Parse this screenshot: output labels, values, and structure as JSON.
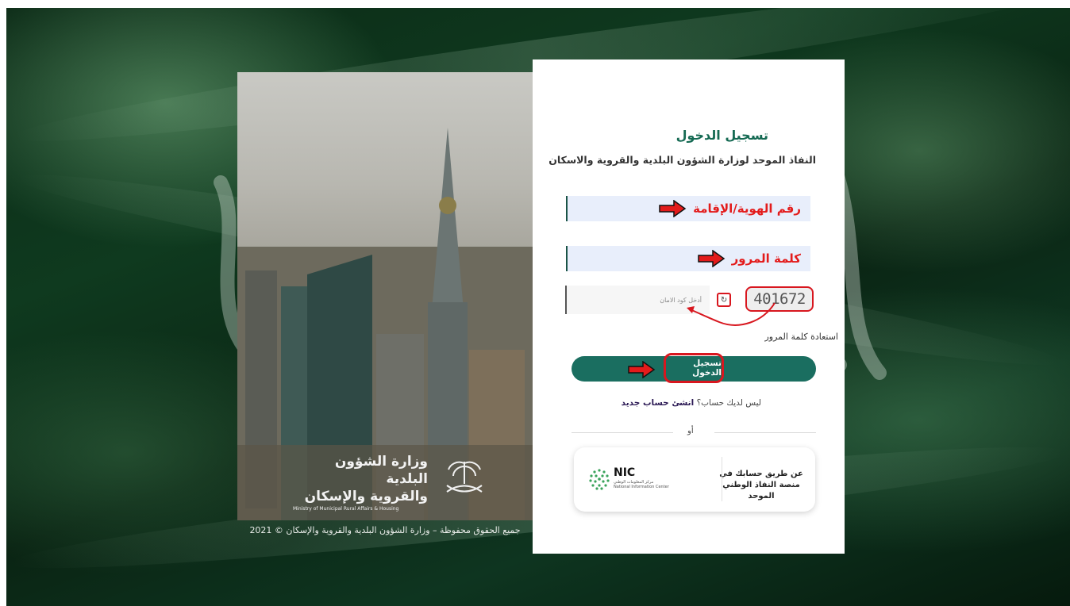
{
  "background": {
    "color": "#0f3a1f"
  },
  "left_panel": {
    "logo_ar_line1": "وزارة الشؤون البلدية",
    "logo_ar_line2": "والقروية والإسكان",
    "logo_en": "Ministry of Municipal Rural Affairs & Housing",
    "copyright": "جميع الحقوق محفوظة – وزارة الشؤون البلدية والقروية والإسكان © 2021"
  },
  "login": {
    "title": "تسجيل الدخول",
    "subtitle": "النفاذ الموحد لوزارة الشؤون البلدية والقروية والاسكان",
    "id_field_annotation": "رقم الهوية/الإقامة",
    "password_field_annotation": "كلمة المرور",
    "captcha_placeholder": "أدخل كود الامان",
    "captcha_code": "401672",
    "forgot_password": "استعادة كلمة المرور",
    "submit_label": "تسجيل الدخول",
    "register_prompt": "ليس لديك حساب؟",
    "register_link": "انشئ حساب جديد",
    "or_text": "أو",
    "nic_text": "عن طريق حسابك في منصة النفاذ الوطني الموحد",
    "nic_logo": "NIC",
    "nic_logo_ar": "مركز المعلومات الوطني",
    "nic_logo_en": "National Information Center"
  },
  "colors": {
    "accent": "#1a6e60",
    "annotation_red": "#e31b1b",
    "title_green": "#156a53",
    "link_purple": "#2c1a55"
  }
}
